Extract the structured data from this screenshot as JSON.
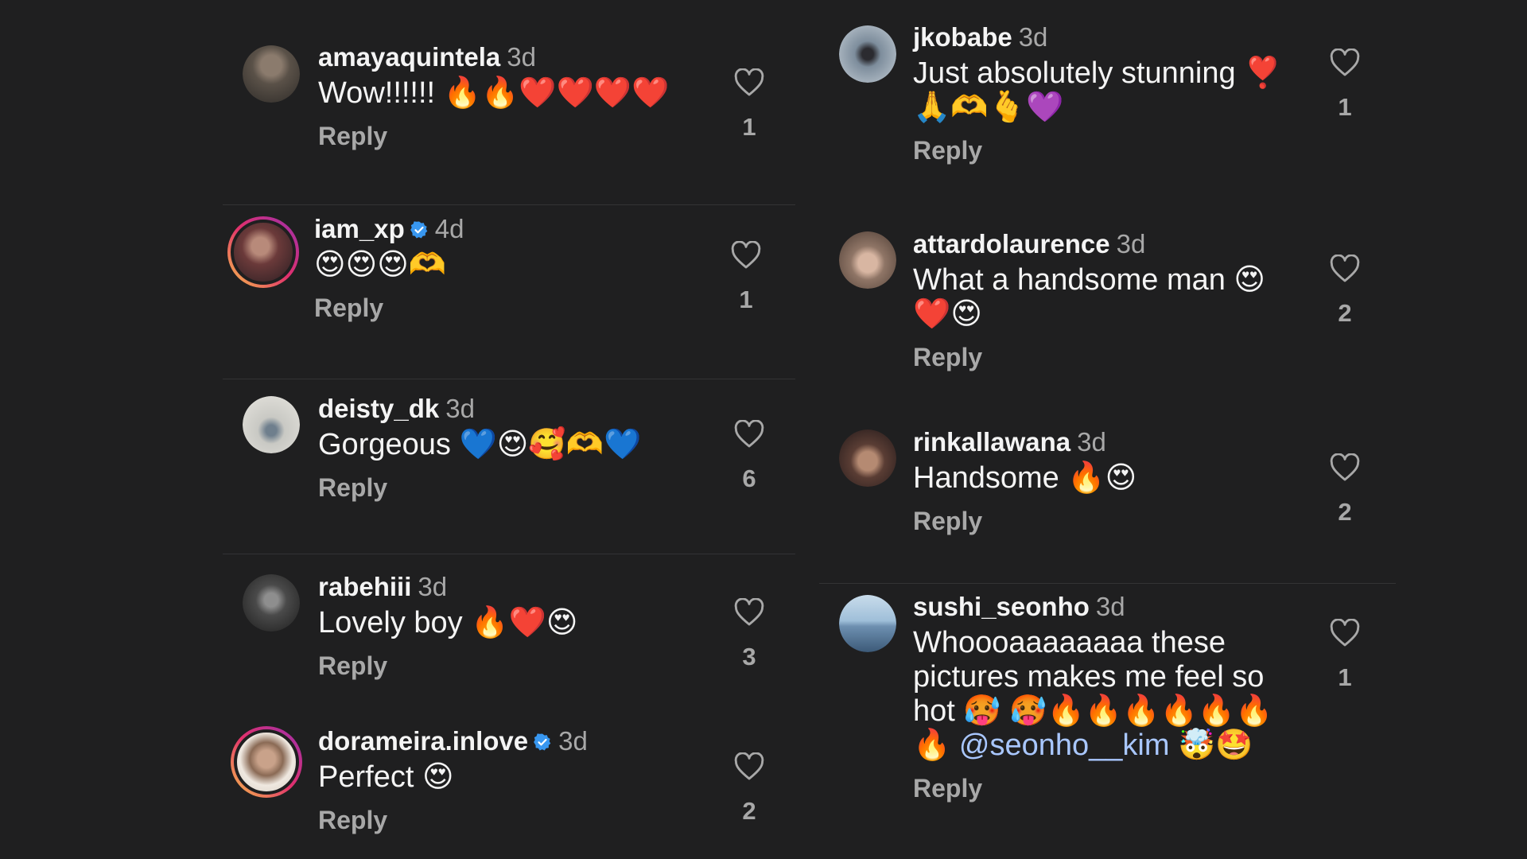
{
  "comments": [
    {
      "username": "amayaquintela",
      "time": "3d",
      "text": "Wow!!!!!! 🔥🔥❤️❤️❤️❤️",
      "reply": "Reply",
      "likes": "1",
      "verified": false,
      "avatar_color": "#5a5148"
    },
    {
      "username": "iam_xp",
      "time": "4d",
      "text": "😍😍😍🫶",
      "reply": "Reply",
      "likes": "1",
      "verified": true,
      "avatar_color": "#6b3a3a"
    },
    {
      "username": "deisty_dk",
      "time": "3d",
      "text": "Gorgeous 💙😍🥰🫶💙",
      "reply": "Reply",
      "likes": "6",
      "verified": false,
      "avatar_color": "#c9c9c4"
    },
    {
      "username": "rabehiii",
      "time": "3d",
      "text": "Lovely boy 🔥❤️😍",
      "reply": "Reply",
      "likes": "3",
      "verified": false,
      "avatar_color": "#4a4a4a"
    },
    {
      "username": "dorameira.inlove",
      "time": "3d",
      "text": "Perfect 😍",
      "reply": "Reply",
      "likes": "2",
      "verified": true,
      "avatar_color": "#8a6a55"
    },
    {
      "username": "jkobabe",
      "time": "3d",
      "text": "Just absolutely stunning ❣️🙏🫶🫰💜",
      "reply": "Reply",
      "likes": "1",
      "verified": false,
      "avatar_color": "#7d8d9c"
    },
    {
      "username": "attardolaurence",
      "time": "3d",
      "text": "What a handsome man 😍❤️😍",
      "reply": "Reply",
      "likes": "2",
      "verified": false,
      "avatar_color": "#8f7566"
    },
    {
      "username": "rinkallawana",
      "time": "3d",
      "text": "Handsome 🔥😍",
      "reply": "Reply",
      "likes": "2",
      "verified": false,
      "avatar_color": "#5a3d34"
    },
    {
      "username": "sushi_seonho",
      "time": "3d",
      "text_before": "Whoooaaaaaaaa these pictures makes me feel so hot 🥵 🥵🔥🔥🔥🔥🔥🔥🔥 ",
      "mention": "@seonho__kim",
      "text_after": " 🤯🤩",
      "reply": "Reply",
      "likes": "1",
      "verified": false,
      "avatar_color": "#6d8fb0"
    }
  ],
  "colors": {
    "background": "#1f1f20",
    "primary_text": "#f4f4f4",
    "secondary_text": "#a8a8a8",
    "verified_badge": "#3897f0",
    "mention": "#a9c7ff"
  },
  "icons": {
    "like": "heart-outline-icon",
    "verified": "verified-badge-icon"
  }
}
